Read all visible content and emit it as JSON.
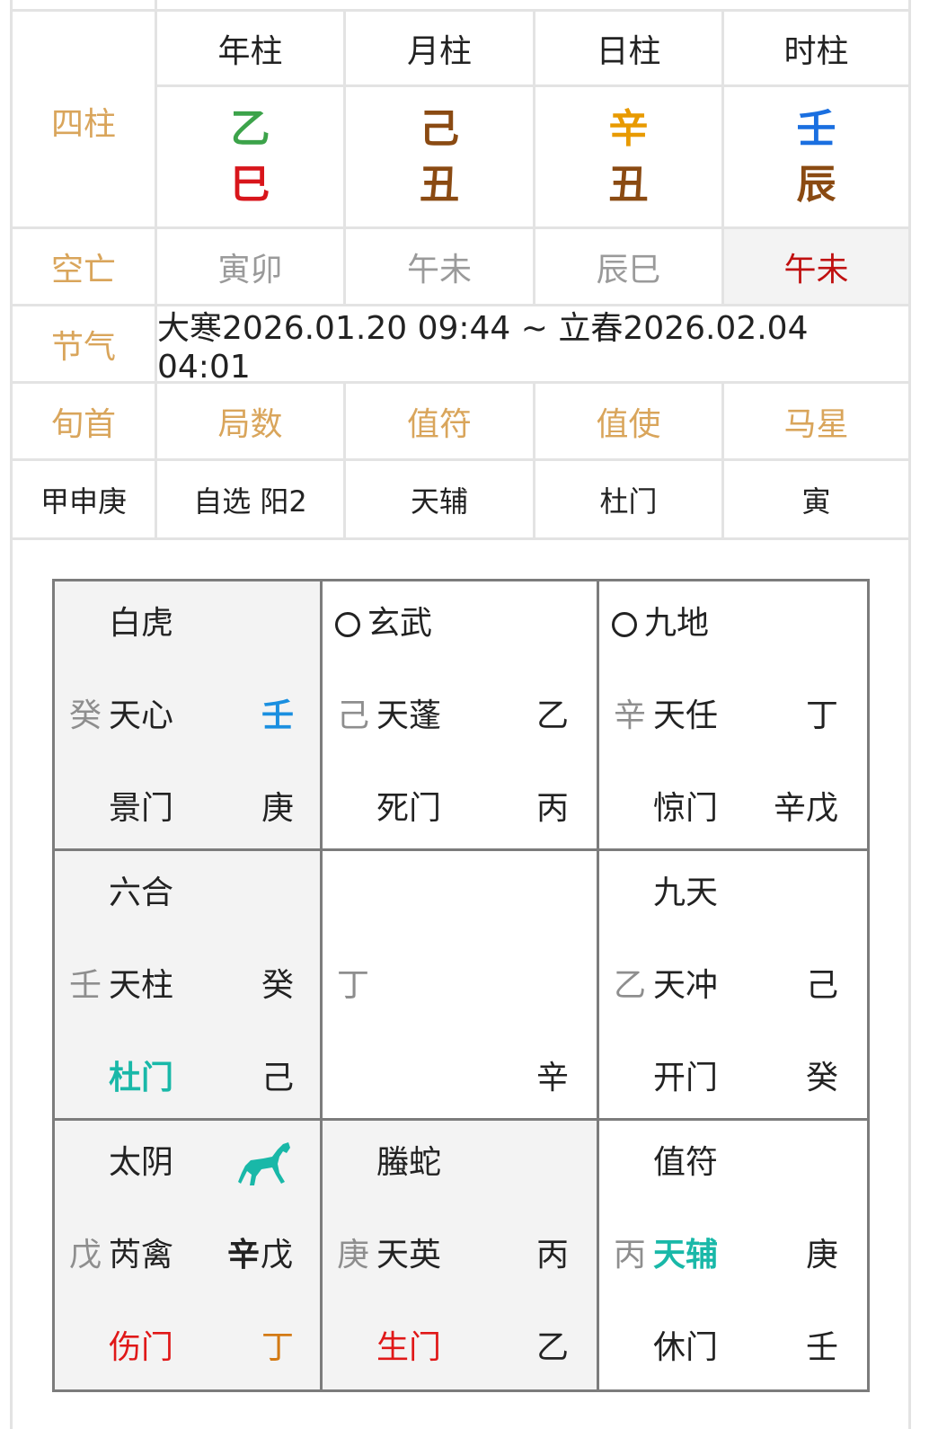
{
  "info": {
    "headers": [
      "年柱",
      "月柱",
      "日柱",
      "时柱"
    ],
    "sizhu_label": "四柱",
    "pillars": [
      {
        "stem": "乙",
        "stem_color": "#3ca34a",
        "branch": "巳",
        "branch_color": "#d8151b"
      },
      {
        "stem": "己",
        "stem_color": "#8a4a12",
        "branch": "丑",
        "branch_color": "#8a4a12"
      },
      {
        "stem": "辛",
        "stem_color": "#e89a00",
        "branch": "丑",
        "branch_color": "#8a4a12"
      },
      {
        "stem": "壬",
        "stem_color": "#1a6fe0",
        "branch": "辰",
        "branch_color": "#8a4a12"
      }
    ],
    "kongwang_label": "空亡",
    "kongwang": [
      "寅卯",
      "午未",
      "辰巳",
      "午未"
    ],
    "jieqi_label": "节气",
    "jieqi_value": "大寒2026.01.20 09:44 ~ 立春2026.02.04 04:01",
    "labels_row": [
      "旬首",
      "局数",
      "值符",
      "值使",
      "马星"
    ],
    "values_row": [
      "甲申庚",
      "自选 阳2",
      "天辅",
      "杜门",
      "寅"
    ]
  },
  "board": {
    "p_nw": {
      "god": "白虎",
      "left": "癸",
      "star": "天心",
      "star_right": "壬",
      "door": "景门",
      "door_right": "庚"
    },
    "p_n": {
      "god": "玄武",
      "left": "己",
      "star": "天蓬",
      "star_right": "乙",
      "door": "死门",
      "door_right": "丙"
    },
    "p_ne": {
      "god": "九地",
      "left": "辛",
      "star": "天任",
      "star_right": "丁",
      "door": "惊门",
      "door_right": "辛戊"
    },
    "p_w": {
      "god": "六合",
      "left": "壬",
      "star": "天柱",
      "star_right": "癸",
      "door": "杜门",
      "door_right": "己"
    },
    "p_c": {
      "left": "丁",
      "bottom_right": "辛"
    },
    "p_e": {
      "god": "九天",
      "left": "乙",
      "star": "天冲",
      "star_right": "己",
      "door": "开门",
      "door_right": "癸"
    },
    "p_sw": {
      "god": "太阴",
      "left": "戊",
      "star": "芮禽",
      "star_right_a": "辛",
      "star_right_b": "戊",
      "door": "伤门",
      "door_right": "丁"
    },
    "p_s": {
      "god": "螣蛇",
      "left": "庚",
      "star": "天英",
      "star_right": "丙",
      "door": "生门",
      "door_right": "乙"
    },
    "p_se": {
      "god": "值符",
      "left": "丙",
      "star": "天辅",
      "star_right": "庚",
      "door": "休门",
      "door_right": "壬"
    }
  }
}
